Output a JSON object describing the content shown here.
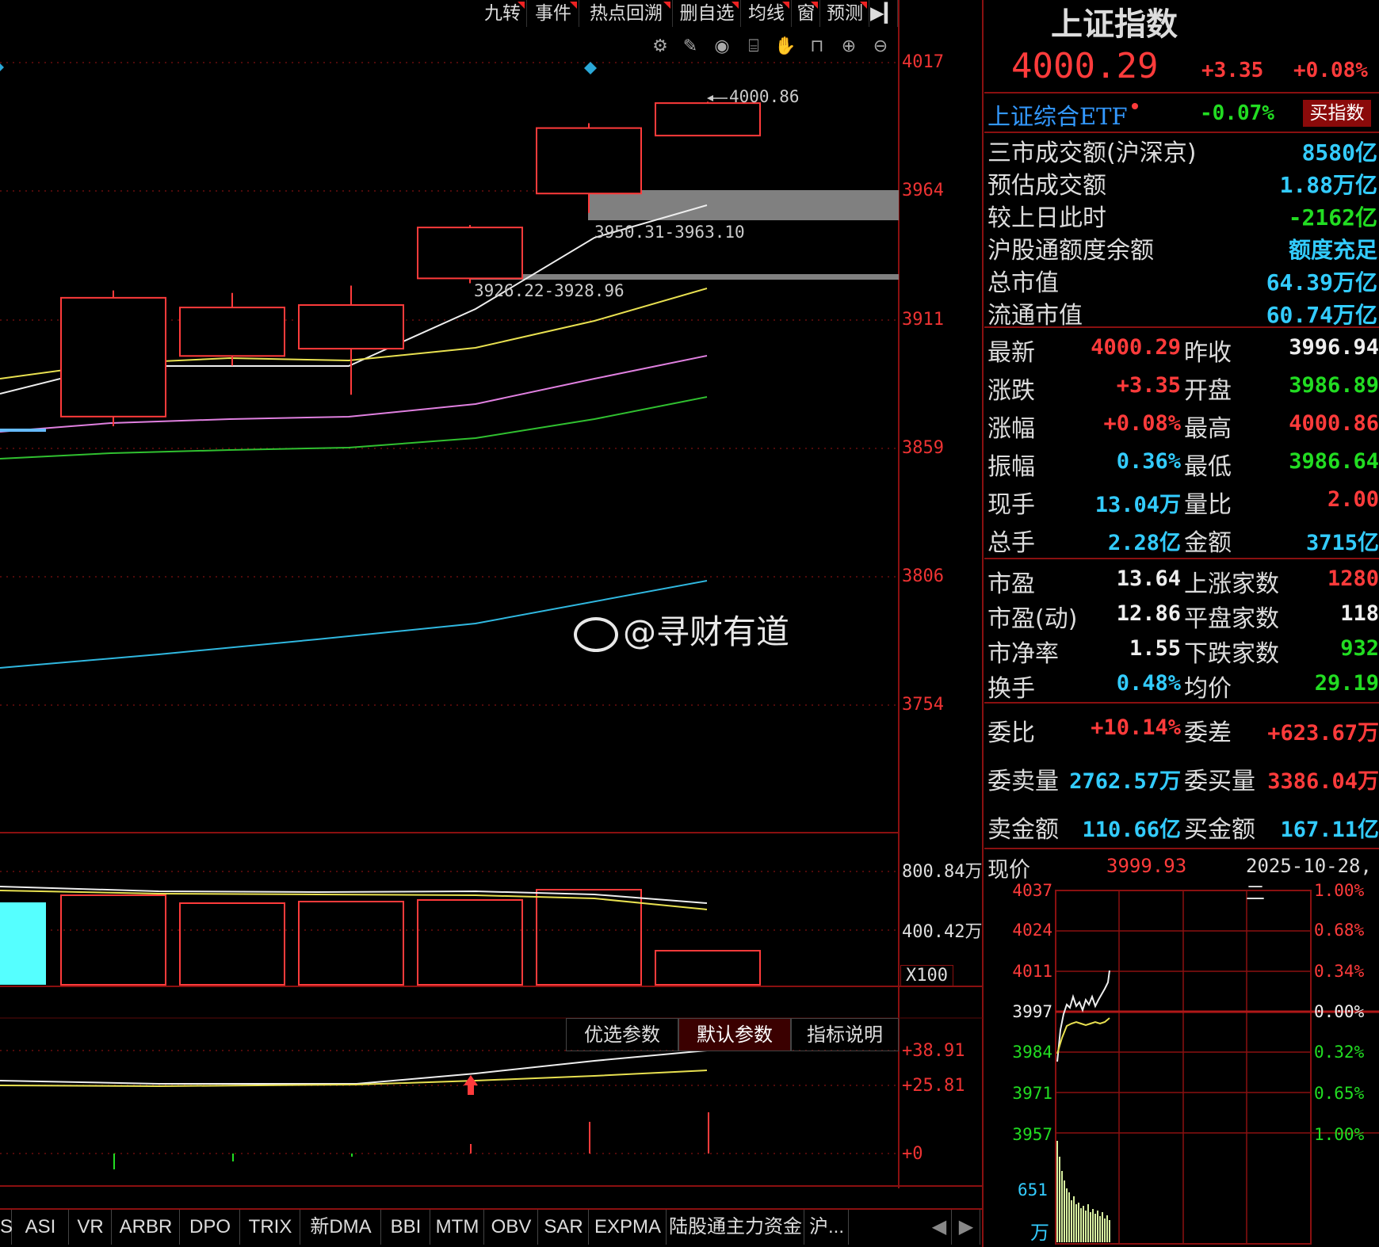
{
  "toolbar": {
    "items": [
      "九转",
      "事件",
      "热点回溯",
      "删自选",
      "均线",
      "窗",
      "预测"
    ],
    "collapse_icon": "collapse-right-icon",
    "tool_icons": [
      "gear-icon",
      "pen-icon",
      "eye-icon",
      "basket-icon",
      "hand-icon",
      "lock-icon",
      "zoom-in-icon",
      "zoom-out-icon"
    ]
  },
  "price_axis": {
    "ticks": [
      "4017",
      "3964",
      "3911",
      "3859",
      "3806",
      "3754"
    ]
  },
  "volume_axis": {
    "ticks": [
      "800.84万",
      "400.42万"
    ],
    "unit": "X100"
  },
  "indicator_axis": {
    "ticks": [
      "+38.91",
      "+25.81",
      "+0"
    ]
  },
  "annotations": {
    "high_label": "4000.86",
    "gap1": "3950.31-3963.10",
    "gap2": "3926.22-3928.96"
  },
  "indicator_tabs": [
    "优选参数",
    "默认参数",
    "指标说明"
  ],
  "indicator_tab_active": 1,
  "bottom_tabs": [
    "S",
    "ASI",
    "VR",
    "ARBR",
    "DPO",
    "TRIX",
    "新DMA",
    "BBI",
    "MTM",
    "OBV",
    "SAR",
    "EXPMA",
    "陆股通主力资金",
    "沪..."
  ],
  "watermark": "@寻财有道",
  "header": {
    "name": "上证指数",
    "price": "4000.29",
    "change": "+3.35",
    "change_pct": "+0.08%",
    "etf_name": "上证综合ETF",
    "etf_pct": "-0.07%",
    "buy_button": "买指数"
  },
  "market_info": [
    {
      "label": "三市成交额(沪深京)",
      "value": "8580亿",
      "color": "cyn"
    },
    {
      "label": "预估成交额",
      "value": "1.88万亿",
      "color": "cyn"
    },
    {
      "label": "较上日此时",
      "value": "-2162亿",
      "color": "grn"
    },
    {
      "label": "沪股通额度余额",
      "value": "额度充足",
      "color": "cyn"
    },
    {
      "label": "总市值",
      "value": "64.39万亿",
      "color": "cyn"
    },
    {
      "label": "流通市值",
      "value": "60.74万亿",
      "color": "cyn"
    }
  ],
  "quote_rows": [
    {
      "l1": "最新",
      "v1": "4000.29",
      "c1": "red",
      "l2": "昨收",
      "v2": "3996.94",
      "c2": "wht"
    },
    {
      "l1": "涨跌",
      "v1": "+3.35",
      "c1": "red",
      "l2": "开盘",
      "v2": "3986.89",
      "c2": "grn"
    },
    {
      "l1": "涨幅",
      "v1": "+0.08%",
      "c1": "red",
      "l2": "最高",
      "v2": "4000.86",
      "c2": "red"
    },
    {
      "l1": "振幅",
      "v1": "0.36%",
      "c1": "cyn",
      "l2": "最低",
      "v2": "3986.64",
      "c2": "grn"
    },
    {
      "l1": "现手",
      "v1": "13.04万",
      "c1": "cyn",
      "l2": "量比",
      "v2": "2.00",
      "c2": "red"
    },
    {
      "l1": "总手",
      "v1": "2.28亿",
      "c1": "cyn",
      "l2": "金额",
      "v2": "3715亿",
      "c2": "cyn"
    }
  ],
  "stat_rows": [
    {
      "l1": "市盈",
      "v1": "13.64",
      "c1": "wht",
      "l2": "上涨家数",
      "v2": "1280",
      "c2": "red"
    },
    {
      "l1": "市盈(动)",
      "v1": "12.86",
      "c1": "wht",
      "l2": "平盘家数",
      "v2": "118",
      "c2": "wht"
    },
    {
      "l1": "市净率",
      "v1": "1.55",
      "c1": "wht",
      "l2": "下跌家数",
      "v2": "932",
      "c2": "grn"
    },
    {
      "l1": "换手",
      "v1": "0.48%",
      "c1": "cyn",
      "l2": "均价",
      "v2": "29.19",
      "c2": "grn"
    }
  ],
  "order_rows": [
    {
      "l1": "委比",
      "v1": "+10.14%",
      "c1": "red",
      "l2": "委差",
      "v2": "+623.67万",
      "c2": "red"
    },
    {
      "l1": "委卖量",
      "v1": "2762.57万",
      "c1": "cyn",
      "l2": "委买量",
      "v2": "3386.04万",
      "c2": "red"
    },
    {
      "l1": "卖金额",
      "v1": "110.66亿",
      "c1": "cyn",
      "l2": "买金额",
      "v2": "167.11亿",
      "c2": "cyn"
    }
  ],
  "mini_chart": {
    "label": "现价",
    "price": "3999.93",
    "date": "2025-10-28,二",
    "left_ticks": [
      "4037",
      "4024",
      "4011",
      "3997",
      "3984",
      "3971",
      "3957"
    ],
    "right_ticks": [
      "1.00%",
      "0.68%",
      "0.34%",
      "0.00%",
      "0.32%",
      "0.65%",
      "1.00%"
    ],
    "vol_tick": "651",
    "vol_unit": "万"
  },
  "chart_data": {
    "type": "candlestick",
    "candles": [
      {
        "open": 3871,
        "close": 3920,
        "high": 3923,
        "low": 3867
      },
      {
        "open": 3896,
        "close": 3916,
        "high": 3922,
        "low": 3892
      },
      {
        "open": 3899,
        "close": 3917,
        "high": 3925,
        "low": 3880
      },
      {
        "open": 3928,
        "close": 3949,
        "high": 3950,
        "low": 3926
      },
      {
        "open": 3963,
        "close": 3990,
        "high": 3992,
        "low": 3955
      },
      {
        "open": 3986.89,
        "close": 4000.29,
        "high": 4000.86,
        "low": 3986.64
      }
    ],
    "yticks": [
      4017,
      3964,
      3911,
      3859,
      3806,
      3754
    ]
  }
}
